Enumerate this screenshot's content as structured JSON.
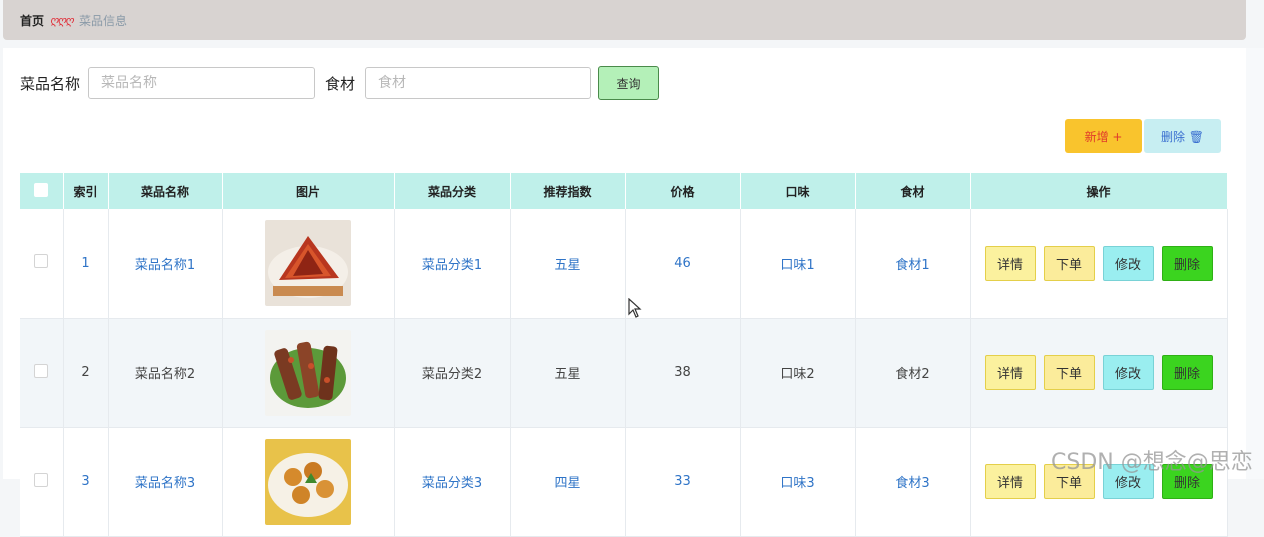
{
  "breadcrumb": {
    "home": "首页",
    "separator": "ღღღ",
    "current": "菜品信息"
  },
  "search": {
    "name_label": "菜品名称",
    "name_placeholder": "菜品名称",
    "ingredient_label": "食材",
    "ingredient_placeholder": "食材",
    "query_label": "查询"
  },
  "toolbar": {
    "add_label": "新增 +",
    "delete_label": "删除 🗑"
  },
  "table": {
    "headers": [
      "索引",
      "菜品名称",
      "图片",
      "菜品分类",
      "推荐指数",
      "价格",
      "口味",
      "食材",
      "操作"
    ],
    "rows": [
      {
        "index": "1",
        "name": "菜品名称1",
        "category": "菜品分类1",
        "rating": "五星",
        "price": "46",
        "taste": "口味1",
        "ingredient": "食材1",
        "image": "red-dish-photo"
      },
      {
        "index": "2",
        "name": "菜品名称2",
        "category": "菜品分类2",
        "rating": "五星",
        "price": "38",
        "taste": "口味2",
        "ingredient": "食材2",
        "image": "skewers-photo"
      },
      {
        "index": "3",
        "name": "菜品名称3",
        "category": "菜品分类3",
        "rating": "四星",
        "price": "33",
        "taste": "口味3",
        "ingredient": "食材3",
        "image": "fried-dish-photo"
      }
    ],
    "actions": {
      "detail": "详情",
      "order": "下单",
      "edit": "修改",
      "delete": "删除"
    }
  },
  "watermark": "CSDN @想念@思恋",
  "colors": {
    "header_bg": "#bff0ea",
    "link": "#2f74c7",
    "add_button": "#f9c42d",
    "delete_button": "#3bd41f"
  }
}
